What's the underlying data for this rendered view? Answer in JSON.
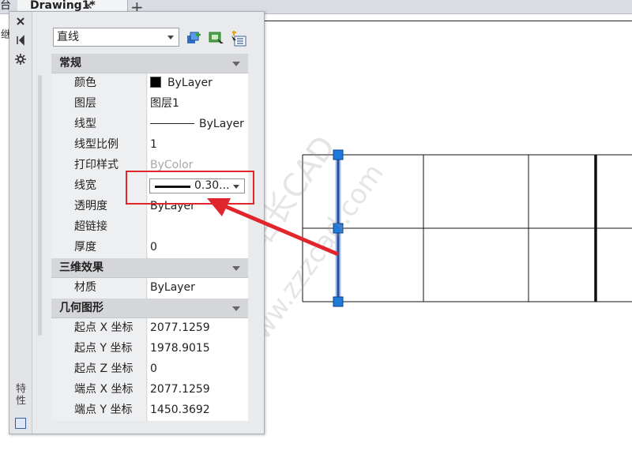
{
  "tabs": {
    "left_partial": "台",
    "active_label": "Drawing1*",
    "close_glyph": "✕",
    "new_glyph": "+"
  },
  "palette": {
    "vertical_title": "特性",
    "left_cut_text": "继",
    "selector_value": "直线",
    "toolbar_icons": [
      "toggle-pickadd-icon",
      "select-objects-icon",
      "quick-select-icon"
    ],
    "side_icons": [
      "close-icon",
      "auto-hide-icon",
      "properties-menu-icon"
    ],
    "sections": [
      {
        "title": "常规",
        "rows": [
          {
            "name": "颜色",
            "value": "ByLayer",
            "kind": "color"
          },
          {
            "name": "图层",
            "value": "图层1",
            "kind": "text"
          },
          {
            "name": "线型",
            "value": "ByLayer",
            "kind": "linetype"
          },
          {
            "name": "线型比例",
            "value": "1",
            "kind": "text"
          },
          {
            "name": "打印样式",
            "value": "ByColor",
            "kind": "dim"
          },
          {
            "name": "线宽",
            "value": "0.30...",
            "kind": "lineweight"
          },
          {
            "name": "透明度",
            "value": "ByLayer",
            "kind": "text"
          },
          {
            "name": "超链接",
            "value": "",
            "kind": "text"
          },
          {
            "name": "厚度",
            "value": "0",
            "kind": "text"
          }
        ]
      },
      {
        "title": "三维效果",
        "rows": [
          {
            "name": "材质",
            "value": "ByLayer",
            "kind": "text"
          }
        ]
      },
      {
        "title": "几何图形",
        "rows": [
          {
            "name": "起点 X 坐标",
            "value": "2077.1259",
            "kind": "text"
          },
          {
            "name": "起点 Y 坐标",
            "value": "1978.9015",
            "kind": "text"
          },
          {
            "name": "起点 Z 坐标",
            "value": "0",
            "kind": "text"
          },
          {
            "name": "端点 X 坐标",
            "value": "2077.1259",
            "kind": "text"
          },
          {
            "name": "端点 Y 坐标",
            "value": "1450.3692",
            "kind": "text"
          }
        ]
      }
    ]
  },
  "watermark": {
    "line1": "图站长CAD",
    "line2": "www.zzzcad.com"
  },
  "colors": {
    "highlight_red": "#e0262c",
    "grip_blue": "#1e7bdc",
    "selected_line": "#2a4fa0"
  }
}
